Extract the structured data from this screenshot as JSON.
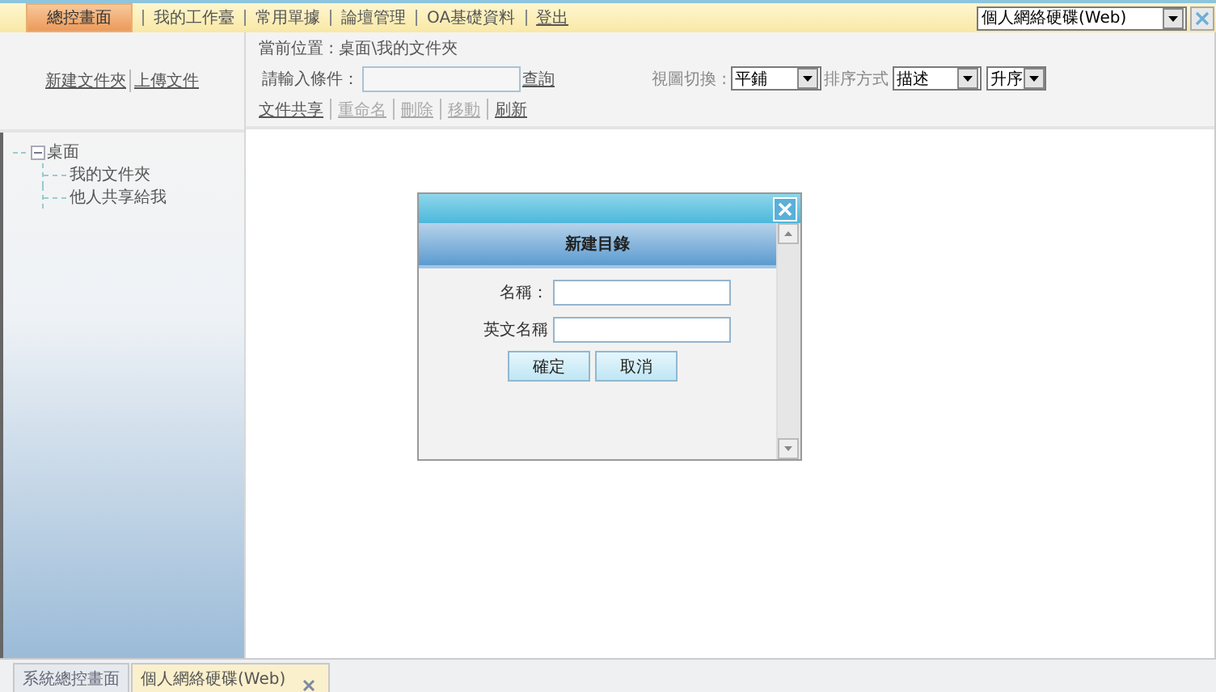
{
  "menu": [
    {
      "label": "總控畫面",
      "selected": true
    },
    {
      "label": "我的工作臺",
      "selected": false
    },
    {
      "label": "常用單據",
      "selected": false
    },
    {
      "label": "論壇管理",
      "selected": false
    },
    {
      "label": "OA基礎資料",
      "selected": false
    },
    {
      "label": "登出",
      "selected": false,
      "kind": "link"
    }
  ],
  "module_select": {
    "value": "個人網絡硬碟(Web)"
  },
  "side_actions": [
    "新建文件夾",
    "上傳文件"
  ],
  "tree": {
    "label": "桌面",
    "expanded": true,
    "children": [
      {
        "label": "我的文件夾"
      },
      {
        "label": "他人共享給我"
      }
    ]
  },
  "location": "當前位置 : 桌面\\我的文件夾",
  "search": {
    "label": "請輸入條件：",
    "button": "查詢"
  },
  "actions": [
    {
      "label": "文件共享",
      "disabled": false
    },
    {
      "label": "重命名",
      "disabled": true
    },
    {
      "label": "刪除",
      "disabled": true
    },
    {
      "label": "移動",
      "disabled": true
    },
    {
      "label": "刷新",
      "disabled": false
    }
  ],
  "view": {
    "label": "視圖切換 :",
    "value": "平鋪"
  },
  "sort": {
    "label": "排序方式",
    "value": "描述"
  },
  "order": {
    "value": "升序"
  },
  "dialog": {
    "title": "新建目錄",
    "fields": [
      {
        "label": "名稱："
      },
      {
        "label": "英文名稱"
      }
    ],
    "buttons": [
      "確定",
      "取消"
    ]
  },
  "bottom_tabs": [
    {
      "label": "系統總控畫面",
      "selected": false
    },
    {
      "label": "個人網絡硬碟(Web)",
      "selected": true
    }
  ]
}
